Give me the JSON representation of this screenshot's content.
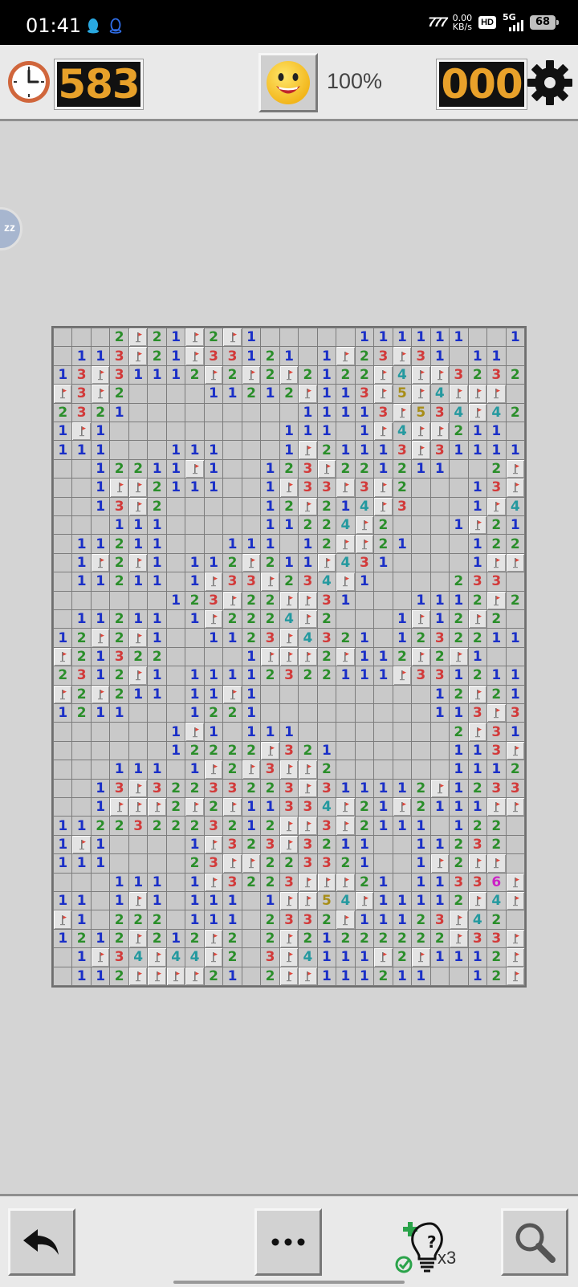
{
  "status_bar": {
    "time": "01:41",
    "carrier": "777",
    "speed_value": "0.00",
    "speed_unit": "KB/s",
    "hd": "HD",
    "network": "5G",
    "battery": "68"
  },
  "header": {
    "timer": "583",
    "progress": "100%",
    "mines_left": "000"
  },
  "bubble": {
    "label": "zz"
  },
  "hint": {
    "count": "x3"
  },
  "board": {
    "cols": 25,
    "rows": [
      "...2F21F2F1.....111111..1F",
      ".113F21F33121.1F23F31.11",
      "13F31112F2F2F212 2F4FF3232",
      "F3F2....1121 2F11 3F5F4FFF",
      "2321.........1111 3F534F42",
      "1F1.........111 .1F4FF211.",
      "111...111...1F2111 3F31111",
      "..12211F1..123F221211..2F3",
      "..1FF2111..1F33F3F2...13FF",
      "..13F2.....12F214F3...1F4F",
      "...111.....1122 4F2...1F21",
      ".1121 1...111.12FF21...122",
      ".1F2F1.112F211F431....1FF",
      ".11211.1F33F23 4F1....233",
      "......123F22FF31...111 2F2",
      ".11211.1F2224F2...1F12F2",
      "12F2F1..112 3F4321.12322 11",
      "F21322....1FFF2F112F2F1..",
      "231 2F1.1111232211 1F331 211",
      "F2F211.11F1.........12F2121",
      "1211...1221.........113F311",
      "......1F1.111........2F311",
      "......122 22F321......113F2",
      "...111.1F2F3FF2......1112F2",
      "..13F32233223F311112F1233",
      "..1FFF2F2F11334F21F2111FF",
      "11223222321 2FF3F2111.122",
      "1F1....1F323F3211..11232",
      "111....23FF2233 21..1F2FF",
      "...111.1F3223FF F21.113 36F",
      "11.1F1.111.1FF54F1111 2F4F",
      "F1.222.111.2332F1112 3F42",
      "1212F212F2.2F2122222 2F33F",
      ".1F34F44F2.3F4111F2F1112F3",
      ".112FFFF21.2FF1112 11..12F"
    ]
  }
}
